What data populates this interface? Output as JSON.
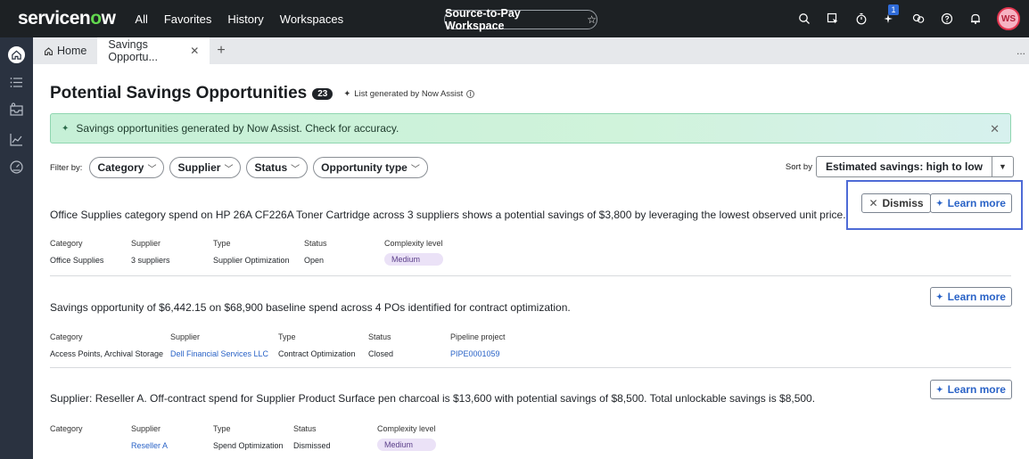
{
  "topnav": {
    "logo": "servicenow",
    "links": [
      "All",
      "Favorites",
      "History",
      "Workspaces"
    ],
    "workspace": "Source-to-Pay Workspace",
    "badge_count": "1",
    "avatar_initials": "WS"
  },
  "tabs": {
    "home": "Home",
    "active": "Savings Opportu...",
    "more": "..."
  },
  "page": {
    "title": "Potential Savings Opportunities",
    "count": "23",
    "generated_note": "List generated by Now Assist"
  },
  "banner": {
    "text": "Savings opportunities generated by Now Assist. Check for accuracy."
  },
  "filters": {
    "label": "Filter by:",
    "pills": [
      "Category",
      "Supplier",
      "Status",
      "Opportunity type"
    ]
  },
  "sort": {
    "label": "Sort by",
    "value": "Estimated savings: high to low"
  },
  "buttons": {
    "dismiss": "Dismiss",
    "learn_more": "Learn more"
  },
  "cards": [
    {
      "description": "Office Supplies category spend on HP 26A CF226A Toner Cartridge across 3 suppliers shows a potential savings of $3,800 by leveraging the lowest observed unit price.",
      "meta": [
        {
          "label": "Category",
          "value": "Office Supplies"
        },
        {
          "label": "Supplier",
          "value": "3 suppliers"
        },
        {
          "label": "Type",
          "value": "Supplier Optimization"
        },
        {
          "label": "Status",
          "value": "Open"
        },
        {
          "label": "Complexity level",
          "value": "Medium"
        }
      ]
    },
    {
      "description": "Savings opportunity of $6,442.15 on $68,900 baseline spend across 4 POs identified for contract optimization.",
      "meta": [
        {
          "label": "Category",
          "value": "Access Points, Archival Storage"
        },
        {
          "label": "Supplier",
          "value": "Dell Financial Services LLC"
        },
        {
          "label": "Type",
          "value": "Contract Optimization"
        },
        {
          "label": "Status",
          "value": "Closed"
        },
        {
          "label": "Pipeline project",
          "value": "PIPE0001059"
        }
      ]
    },
    {
      "description": "Supplier: Reseller A. Off-contract spend for Supplier Product Surface pen charcoal is $13,600 with potential savings of $8,500. Total unlockable savings is $8,500.",
      "meta": [
        {
          "label": "Category",
          "value": ""
        },
        {
          "label": "Supplier",
          "value": "Reseller A"
        },
        {
          "label": "Type",
          "value": "Spend Optimization"
        },
        {
          "label": "Status",
          "value": "Dismissed"
        },
        {
          "label": "Complexity level",
          "value": "Medium"
        }
      ]
    }
  ]
}
